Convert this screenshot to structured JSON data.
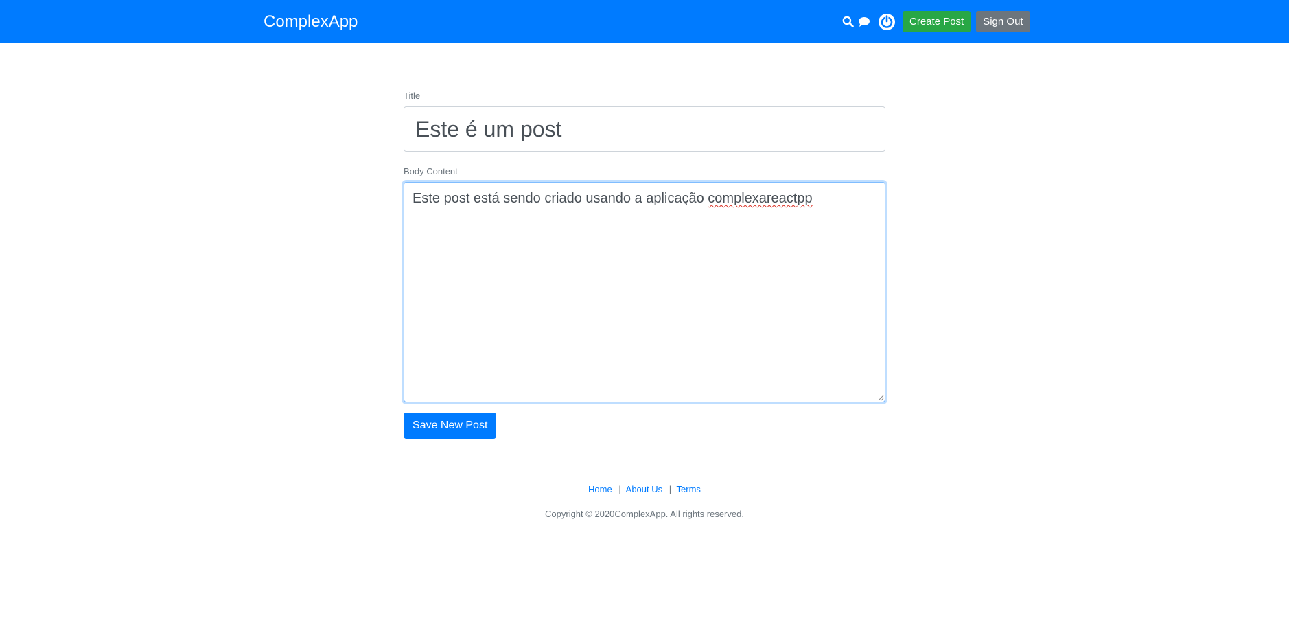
{
  "header": {
    "brand": "ComplexApp",
    "icons": {
      "search": "search-icon",
      "chat": "chat-icon",
      "avatar": "power-avatar-icon"
    },
    "create_post_label": "Create Post",
    "sign_out_label": "Sign Out"
  },
  "form": {
    "title_label": "Title",
    "title_value": "Este é um post",
    "body_label": "Body Content",
    "body_value_prefix": "Este post está sendo criado usando a aplicação ",
    "body_value_misspelled": "complexareactpp",
    "save_label": "Save New Post"
  },
  "footer": {
    "links": [
      {
        "label": "Home"
      },
      {
        "label": "About Us"
      },
      {
        "label": "Terms"
      }
    ],
    "separator": "|",
    "copyright": "Copyright © 2020ComplexApp. All rights reserved."
  },
  "colors": {
    "primary": "#007bff",
    "success": "#28a745",
    "secondary": "#6c757d",
    "spellcheck": "#d93025"
  }
}
